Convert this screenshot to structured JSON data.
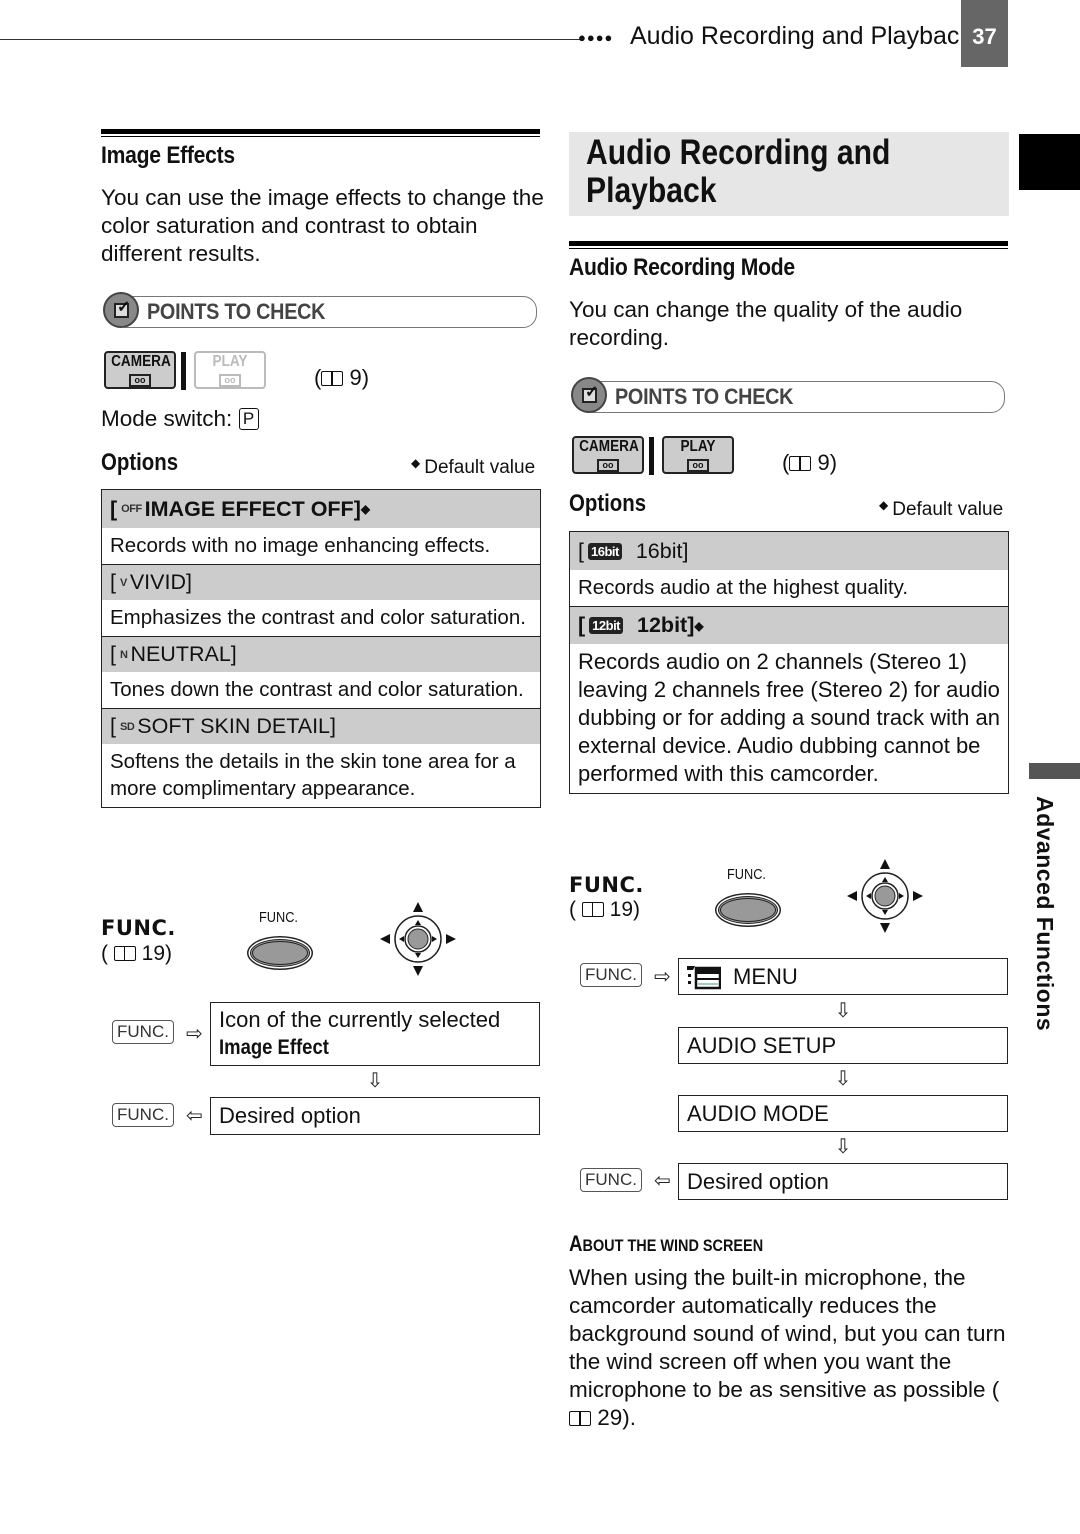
{
  "header": {
    "running_title": "Audio Recording and Playback",
    "page_number": "37",
    "dots": "●●●●"
  },
  "side": {
    "chapter_label": "Advanced Functions"
  },
  "left": {
    "section_title": "Image Effects",
    "intro": "You can use the image effects to change the color saturation and contrast to obtain different results.",
    "points_to_check": "POINTS TO CHECK",
    "modes": [
      {
        "label": "CAMERA",
        "tape": "oo",
        "active": true
      },
      {
        "label": "PLAY",
        "tape": "oo",
        "active": false
      }
    ],
    "page_ref": "9",
    "mode_switch_label": "Mode switch:",
    "mode_switch_value": "P",
    "options_heading": "Options",
    "default_value_label": "Default value",
    "options": [
      {
        "icon": "OFF",
        "name": "IMAGE EFFECT OFF]",
        "default": true,
        "desc": "Records with no image enhancing effects."
      },
      {
        "icon": "V",
        "name": "VIVID]",
        "default": false,
        "desc": "Emphasizes the contrast and color saturation."
      },
      {
        "icon": "N",
        "name": "NEUTRAL]",
        "default": false,
        "desc": "Tones down the contrast and color saturation."
      },
      {
        "icon": "SD",
        "name": "SOFT SKIN DETAIL]",
        "default": false,
        "desc": "Softens the details in the skin tone area for a more complimentary appearance."
      }
    ],
    "func": {
      "label": "FUNC.",
      "page_ref": "19",
      "button_caption": "FUNC.",
      "key_label": "FUNC.",
      "steps": [
        {
          "line1": "Icon of the currently selected",
          "line2": "Image Effect"
        },
        {
          "line1": "Desired option"
        }
      ]
    }
  },
  "right": {
    "chapter_title_line1": "Audio Recording and",
    "chapter_title_line2": "Playback",
    "section_title": "Audio Recording Mode",
    "intro": "You can change the quality of the audio recording.",
    "points_to_check": "POINTS TO CHECK",
    "modes": [
      {
        "label": "CAMERA",
        "tape": "oo",
        "active": true
      },
      {
        "label": "PLAY",
        "tape": "oo",
        "active": true
      }
    ],
    "page_ref": "9",
    "options_heading": "Options",
    "default_value_label": "Default value",
    "options": [
      {
        "icon": "16bit",
        "name": "16bit]",
        "default": false,
        "desc": "Records audio at the highest quality."
      },
      {
        "icon": "12bit",
        "name": "12bit]",
        "default": true,
        "desc": "Records audio on 2 channels (Stereo 1) leaving 2 channels free (Stereo 2) for audio dubbing or for adding a sound track with an external device. Audio dubbing cannot be performed with this camcorder."
      }
    ],
    "func": {
      "label": "FUNC.",
      "page_ref": "19",
      "button_caption": "FUNC.",
      "key_label": "FUNC.",
      "steps": [
        "MENU",
        "AUDIO  SETUP",
        "AUDIO MODE",
        "Desired option"
      ]
    },
    "about": {
      "heading_first": "A",
      "heading_rest": "BOUT THE WIND SCREEN",
      "text": "When using the built-in microphone, the camcorder automatically reduces the background sound of wind, but you can turn the wind screen off when you want the microphone to be as sensitive as possible (",
      "page_ref": "29",
      "text_end": ")."
    }
  }
}
